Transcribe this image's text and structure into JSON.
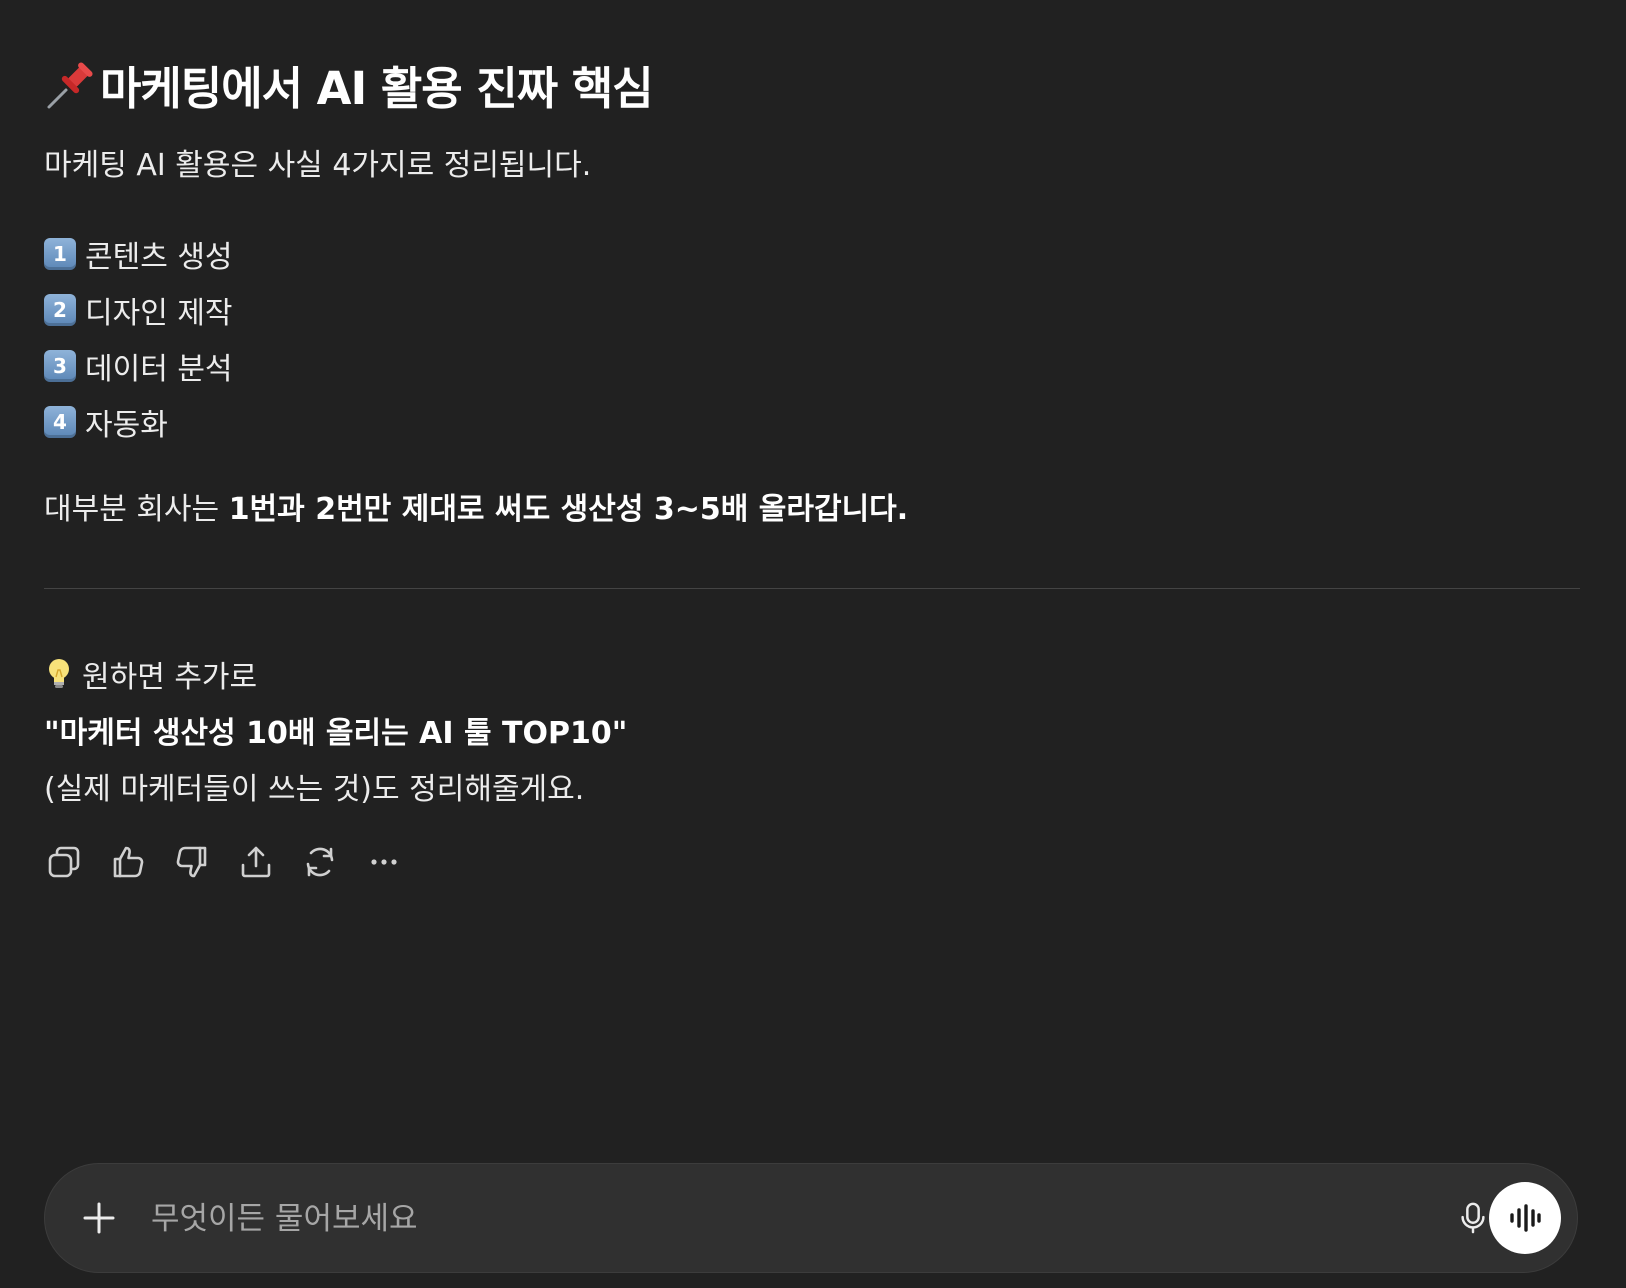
{
  "message": {
    "heading": "마케팅에서 AI 활용 진짜 핵심",
    "heading_icon": "pushpin-icon",
    "intro": "마케팅 AI 활용은 사실 4가지로 정리됩니다.",
    "list": [
      {
        "key": "1",
        "label": "콘텐츠 생성"
      },
      {
        "key": "2",
        "label": "디자인 제작"
      },
      {
        "key": "3",
        "label": "데이터 분석"
      },
      {
        "key": "4",
        "label": "자동화"
      }
    ],
    "summary_prefix": "대부분 회사는 ",
    "summary_bold": "1번과 2번만 제대로 써도 생산성 3~5배 올라갑니다.",
    "tip_icon": "light-bulb-icon",
    "tip": "원하면 추가로",
    "quote": "\"마케터 생산성 10배 올리는 AI 툴 TOP10\"",
    "note": "(실제 마케터들이 쓰는 것)도 정리해줄게요."
  },
  "actions": [
    "copy-icon",
    "thumbs-up-icon",
    "thumbs-down-icon",
    "share-icon",
    "regenerate-icon",
    "more-icon"
  ],
  "composer": {
    "placeholder": "무엇이든 물어보세요",
    "value": ""
  },
  "colors": {
    "background": "#212121",
    "composer": "#303030",
    "text": "#ececec"
  }
}
